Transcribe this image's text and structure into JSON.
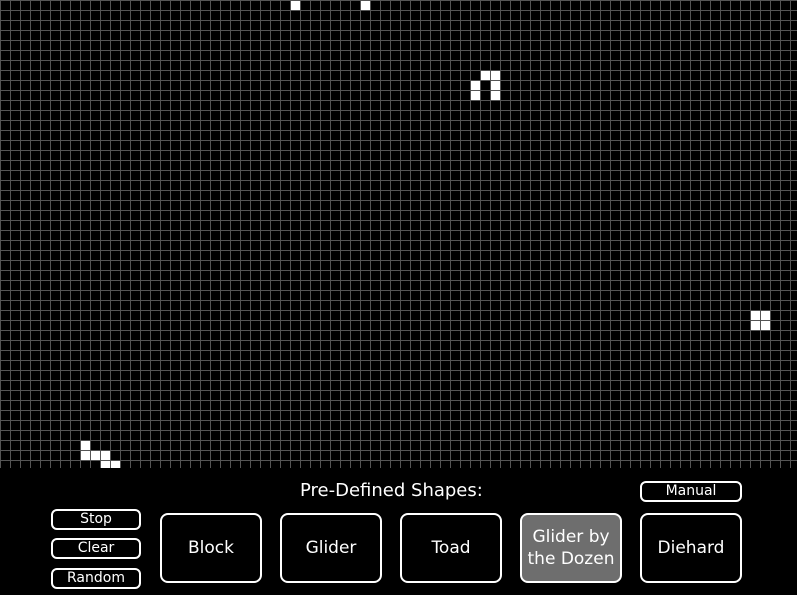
{
  "board": {
    "background": "#000000",
    "alive_color": "#ffffff",
    "grid_color": "#555555",
    "live_cells": [
      [
        0,
        29
      ],
      [
        0,
        36
      ],
      [
        8,
        47
      ],
      [
        9,
        47
      ],
      [
        7,
        48
      ],
      [
        7,
        49
      ],
      [
        8,
        49
      ],
      [
        9,
        49
      ],
      [
        31,
        75
      ],
      [
        31,
        76
      ],
      [
        32,
        75
      ],
      [
        32,
        76
      ],
      [
        44,
        8
      ],
      [
        45,
        8
      ],
      [
        45,
        9
      ],
      [
        45,
        10
      ],
      [
        46,
        10
      ],
      [
        46,
        11
      ]
    ]
  },
  "panel": {
    "title": "Pre-Defined Shapes:",
    "manual_label": "Manual",
    "controls": {
      "stop": "Stop",
      "clear": "Clear",
      "random": "Random"
    },
    "shapes": [
      {
        "label": "Block",
        "active": false
      },
      {
        "label": "Glider",
        "active": false
      },
      {
        "label": "Toad",
        "active": false
      },
      {
        "label": "Glider by the Dozen",
        "active": true
      },
      {
        "label": "Diehard",
        "active": false
      }
    ]
  }
}
